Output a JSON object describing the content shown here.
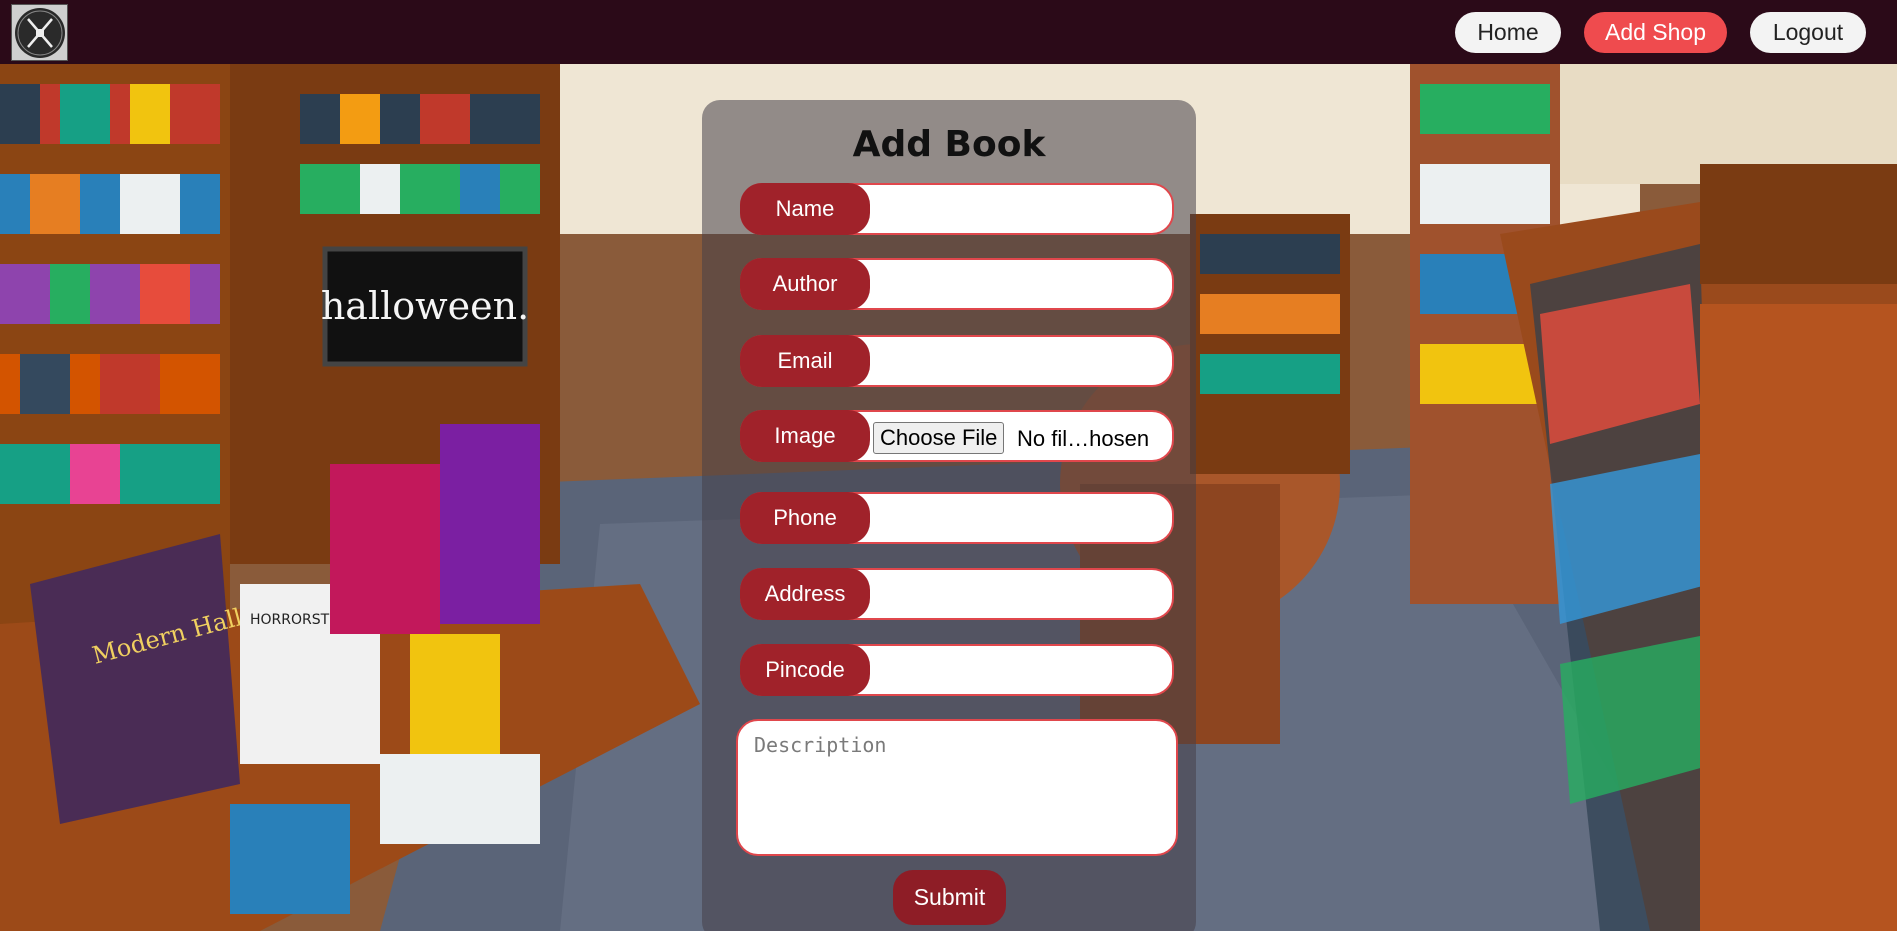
{
  "nav": {
    "home_label": "Home",
    "add_shop_label": "Add Shop",
    "logout_label": "Logout"
  },
  "form": {
    "title": "Add Book",
    "fields": [
      {
        "label": "Name",
        "value": ""
      },
      {
        "label": "Author",
        "value": ""
      },
      {
        "label": "Email",
        "value": ""
      },
      {
        "label": "Image",
        "button": "Choose File",
        "status": "No fil…hosen"
      },
      {
        "label": "Phone",
        "value": ""
      },
      {
        "label": "Address",
        "value": ""
      },
      {
        "label": "Pincode",
        "value": ""
      }
    ],
    "description_placeholder": "Description",
    "submit_label": "Submit"
  },
  "background": {
    "sign_text": "halloween.",
    "book_title": "Modern Halloween",
    "book_2": "HORRORSTÖR"
  },
  "colors": {
    "navbar": "#2b0a18",
    "accent_red": "#ef4b4e",
    "label_red": "#a0222a",
    "submit_red": "#8e1d26"
  }
}
